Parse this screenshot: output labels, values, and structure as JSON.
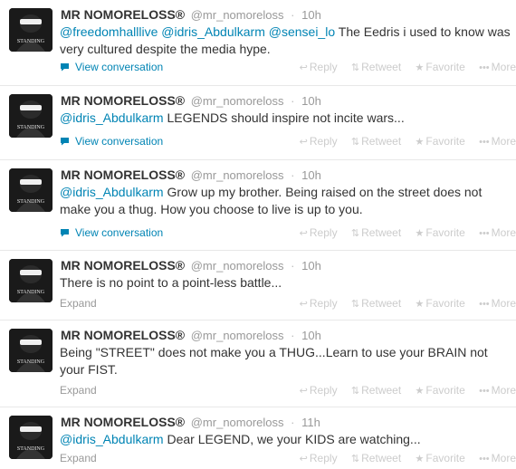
{
  "tweets": [
    {
      "fullname": "MR NOMORELOSS®",
      "username": "@mr_nomoreloss",
      "separator": "·",
      "time": "10h",
      "mentions": [
        "@freedomhalllive",
        "@idris_Abdulkarm",
        "@sensei_lo"
      ],
      "text": "The Eedris i used to know was very cultured despite the media hype.",
      "link": "View conversation"
    },
    {
      "fullname": "MR NOMORELOSS®",
      "username": "@mr_nomoreloss",
      "separator": "·",
      "time": "10h",
      "mentions": [
        "@idris_Abdulkarm"
      ],
      "text": "LEGENDS should inspire not incite wars...",
      "link": "View conversation"
    },
    {
      "fullname": "MR NOMORELOSS®",
      "username": "@mr_nomoreloss",
      "separator": "·",
      "time": "10h",
      "mentions": [
        "@idris_Abdulkarm"
      ],
      "text": "Grow up my brother. Being raised on the street does not make you a thug. How you choose to live is up to you.",
      "link": "View conversation"
    },
    {
      "fullname": "MR NOMORELOSS®",
      "username": "@mr_nomoreloss",
      "separator": "·",
      "time": "10h",
      "mentions": [],
      "text": "There is no point to a point-less battle...",
      "link": "Expand"
    },
    {
      "fullname": "MR NOMORELOSS®",
      "username": "@mr_nomoreloss",
      "separator": "·",
      "time": "10h",
      "mentions": [],
      "text": "Being \"STREET\" does not make you a THUG...Learn to use your BRAIN not your FIST.",
      "link": "Expand"
    },
    {
      "fullname": "MR NOMORELOSS®",
      "username": "@mr_nomoreloss",
      "separator": "·",
      "time": "11h",
      "mentions": [
        "@idris_Abdulkarm"
      ],
      "text": "Dear LEGEND, we your KIDS are watching...",
      "link": "Expand"
    }
  ],
  "actions": {
    "reply": "Reply",
    "retweet": "Retweet",
    "favorite": "Favorite",
    "more": "More"
  },
  "avatar_text": "STANDING",
  "colors": {
    "link": "#0084b4",
    "muted": "#999999",
    "action": "#cccccc",
    "text": "#333333"
  },
  "icons": {
    "conversation": "speech-bubble-icon",
    "reply": "reply-arrow-icon",
    "retweet": "retweet-icon",
    "favorite": "star-icon",
    "more": "more-dots-icon"
  }
}
